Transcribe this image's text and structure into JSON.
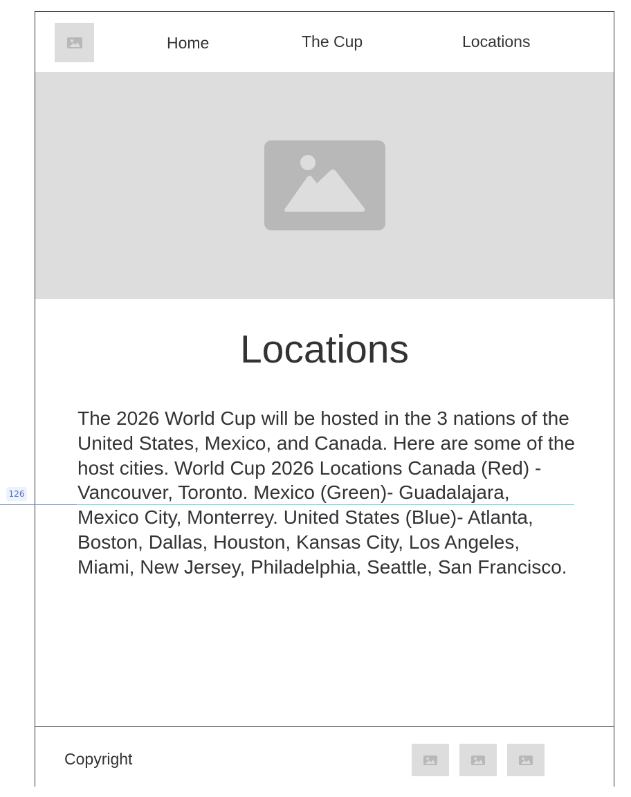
{
  "nav": {
    "logo_icon": "image-placeholder-icon",
    "items": [
      {
        "label": "Home"
      },
      {
        "label": "The Cup"
      },
      {
        "label": "Locations"
      }
    ]
  },
  "hero": {
    "icon": "image-placeholder-icon"
  },
  "main": {
    "title": "Locations",
    "body": "The 2026 World Cup will be hosted in the 3 nations of the United States, Mexico, and Canada. Here are some of the host cities. World Cup 2026 Locations Canada (Red) - Vancouver, Toronto. Mexico (Green)- Guadalajara, Mexico City, Monterrey. United States (Blue)- Atlanta, Boston, Dallas, Houston, Kansas City, Los Angeles, Miami, New Jersey, Philadelphia, Seattle, San Francisco."
  },
  "footer": {
    "copyright": "Copyright",
    "social_icons": [
      "image-placeholder-icon",
      "image-placeholder-icon",
      "image-placeholder-icon"
    ]
  },
  "overlay": {
    "guide_value": "126"
  },
  "colors": {
    "placeholder_bg": "#dddddd",
    "placeholder_icon": "#b8b8b8",
    "text": "#333333",
    "guide_blue": "#4a72c8",
    "guide_cyan": "#5fd3e0"
  }
}
